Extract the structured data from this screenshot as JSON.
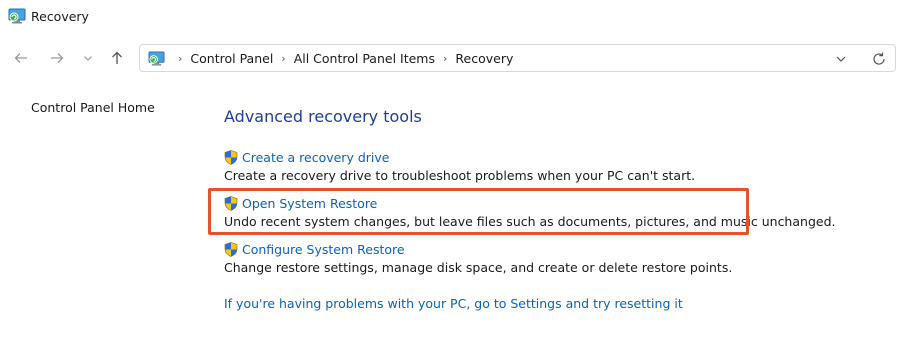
{
  "window": {
    "title": "Recovery",
    "app_icon": "control-panel-recovery-icon"
  },
  "navigation": {
    "back_icon": "arrow-left-icon",
    "forward_icon": "arrow-right-icon",
    "recent_icon": "chevron-down-icon",
    "up_icon": "arrow-up-icon"
  },
  "address_bar": {
    "icon": "control-panel-recovery-icon",
    "breadcrumbs": [
      "Control Panel",
      "All Control Panel Items",
      "Recovery"
    ],
    "separator": "›",
    "dropdown_icon": "chevron-down-icon",
    "refresh_icon": "refresh-icon"
  },
  "sidebar": {
    "home_link": "Control Panel Home"
  },
  "main": {
    "heading": "Advanced recovery tools",
    "tasks": [
      {
        "label": "Create a recovery drive",
        "description": "Create a recovery drive to troubleshoot problems when your PC can't start.",
        "icon": "uac-shield-icon"
      },
      {
        "label": "Open System Restore",
        "description": "Undo recent system changes, but leave files such as documents, pictures, and music unchanged.",
        "icon": "uac-shield-icon",
        "highlighted": true
      },
      {
        "label": "Configure System Restore",
        "description": "Change restore settings, manage disk space, and create or delete restore points.",
        "icon": "uac-shield-icon"
      }
    ],
    "reset_link": "If you're having problems with your PC, go to Settings and try resetting it"
  },
  "colors": {
    "heading": "#1e3f9a",
    "link": "#0a62b8",
    "highlight_border": "#e2542a",
    "text": "#1a1a1a"
  }
}
